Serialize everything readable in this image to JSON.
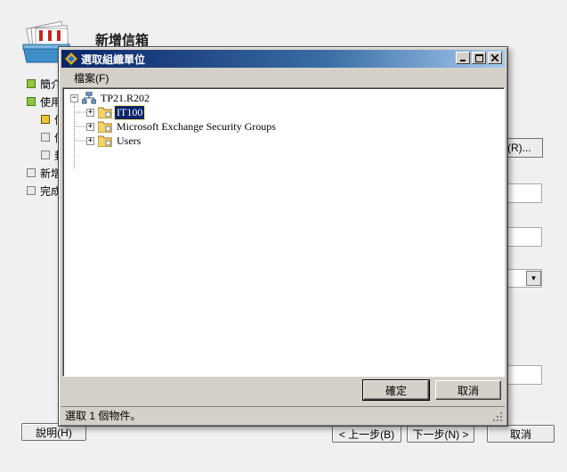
{
  "wizard": {
    "title": "新增信箱",
    "steps": [
      {
        "label": "簡介",
        "state": "done"
      },
      {
        "label": "使用者類型",
        "state": "done"
      },
      {
        "label": "信箱資訊",
        "state": "current"
      },
      {
        "label": "信箱設定",
        "state": "pending"
      },
      {
        "label": "封存設定",
        "state": "pending"
      },
      {
        "label": "新增信箱",
        "state": "pending"
      },
      {
        "label": "完成",
        "state": "pending"
      }
    ],
    "browse_label": "(R)...",
    "help_label": "說明(H)",
    "back_label": "< 上一步(B)",
    "next_label": "下一步(N) >",
    "cancel_label": "取消"
  },
  "dialog": {
    "title": "選取組織單位",
    "menu": {
      "file": "檔案(F)"
    },
    "tree": {
      "root": "TP21.R202",
      "children": [
        {
          "label": "IT100",
          "selected": true
        },
        {
          "label": "Microsoft Exchange Security Groups",
          "selected": false
        },
        {
          "label": "Users",
          "selected": false
        }
      ]
    },
    "ok_label": "確定",
    "cancel_label": "取消",
    "status": "選取 1 個物件。"
  }
}
